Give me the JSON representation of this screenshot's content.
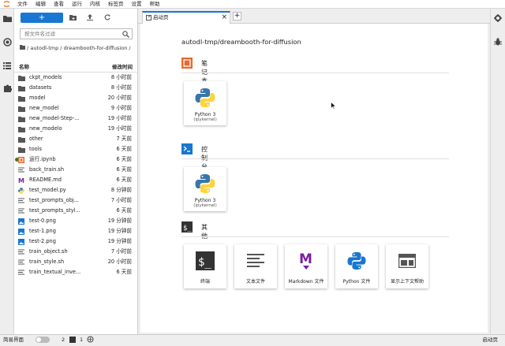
{
  "menubar": {
    "items": [
      "文件",
      "编辑",
      "查看",
      "运行",
      "内核",
      "标签页",
      "设置",
      "帮助"
    ]
  },
  "browser": {
    "new_label": "+",
    "search_placeholder": "按文件名过滤",
    "breadcrumb": "/ autodl-tmp / dreambooth-for-diffusion /",
    "col_name": "名称",
    "col_modified": "修改时间",
    "items": [
      {
        "type": "folder",
        "name": "ckpt_models",
        "modified": "8 小时前"
      },
      {
        "type": "folder",
        "name": "datasets",
        "modified": "8 小时前"
      },
      {
        "type": "folder",
        "name": "model",
        "modified": "20 小时前"
      },
      {
        "type": "folder",
        "name": "new_model",
        "modified": "9 小时前"
      },
      {
        "type": "folder",
        "name": "new_model-Step-...",
        "modified": "19 小时前"
      },
      {
        "type": "folder",
        "name": "new_modelo",
        "modified": "19 小时前"
      },
      {
        "type": "folder",
        "name": "other",
        "modified": "7 天前"
      },
      {
        "type": "folder",
        "name": "tools",
        "modified": "6 天前"
      },
      {
        "type": "notebook",
        "name": "运行.ipynb",
        "modified": "6 天前",
        "running": true
      },
      {
        "type": "file",
        "name": "back_train.sh",
        "modified": "6 天前"
      },
      {
        "type": "markdown",
        "name": "README.md",
        "modified": "6 天前"
      },
      {
        "type": "python",
        "name": "test_model.py",
        "modified": "8 分钟前"
      },
      {
        "type": "file",
        "name": "test_prompts_obj...",
        "modified": "7 小时前"
      },
      {
        "type": "file",
        "name": "test_prompts_styl...",
        "modified": "6 天前"
      },
      {
        "type": "image",
        "name": "test-0.png",
        "modified": "19 分钟前"
      },
      {
        "type": "image",
        "name": "test-1.png",
        "modified": "19 分钟前"
      },
      {
        "type": "image",
        "name": "test-2.png",
        "modified": "19 分钟前"
      },
      {
        "type": "file",
        "name": "train_object.sh",
        "modified": "7 小时前"
      },
      {
        "type": "file",
        "name": "train_style.sh",
        "modified": "20 小时前"
      },
      {
        "type": "file",
        "name": "train_textual_inve...",
        "modified": "6 天前"
      }
    ]
  },
  "tab": {
    "title": "启动页",
    "close": "×",
    "add": "+"
  },
  "launcher": {
    "path": "autodl-tmp/dreambooth-for-diffusion",
    "notebook_section": "笔记本",
    "console_section": "控制台",
    "other_section": "其他",
    "notebook_cards": [
      {
        "label": "Python 3",
        "sub": "(ipykernel)"
      }
    ],
    "console_cards": [
      {
        "label": "Python 3",
        "sub": "(ipykernel)"
      }
    ],
    "other_cards": [
      {
        "icon": "terminal-icon",
        "label": "终端"
      },
      {
        "icon": "text-file-icon",
        "label": "文本文件"
      },
      {
        "icon": "markdown-icon",
        "label": "Markdown 文件"
      },
      {
        "icon": "python-icon",
        "label": "Python 文件"
      },
      {
        "icon": "context-help-icon",
        "label": "显示上下文帮助"
      }
    ]
  },
  "status": {
    "simple_mode": "简易界面",
    "kernels": "2",
    "terminals": "1",
    "right": "启动页"
  },
  "colors": {
    "accent": "#1976d2",
    "notebook_orange": "#e8692a",
    "console_blue": "#1976d2",
    "markdown_purple": "#7b1fa2"
  }
}
